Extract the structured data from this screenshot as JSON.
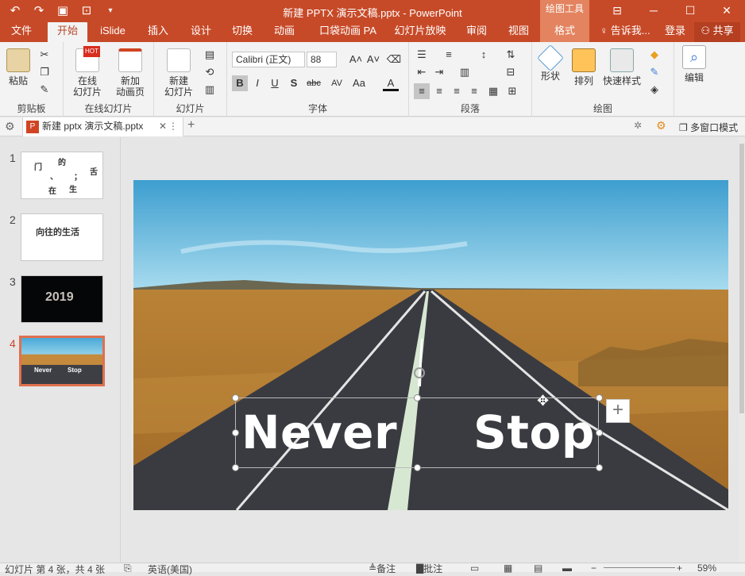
{
  "window": {
    "title": "新建 PPTX 演示文稿.pptx - PowerPoint",
    "context_tools": "绘图工具",
    "buttons": [
      "restore-ribbon",
      "minimize",
      "maximize",
      "close"
    ]
  },
  "tabs": [
    {
      "label": "文件"
    },
    {
      "label": "开始"
    },
    {
      "label": "iSlide"
    },
    {
      "label": "插入"
    },
    {
      "label": "设计"
    },
    {
      "label": "切换"
    },
    {
      "label": "动画"
    },
    {
      "label": "口袋动画 PA"
    },
    {
      "label": "幻灯片放映"
    },
    {
      "label": "审阅"
    },
    {
      "label": "视图"
    },
    {
      "label": "格式"
    }
  ],
  "tellme": "告诉我...",
  "login": "登录",
  "share": "共享",
  "ribbon": {
    "clipboard": {
      "paste": "粘贴",
      "label": "剪贴板"
    },
    "online": {
      "btn1": "在线\n幻灯片",
      "btn2": "新加\n动画页",
      "label": "在线幻灯片",
      "hot": "HOT"
    },
    "slides": {
      "btn": "新建\n幻灯片",
      "label": "幻灯片"
    },
    "font": {
      "name": "Calibri (正文)",
      "size": "88",
      "label": "字体",
      "b": "B",
      "i": "I",
      "u": "U",
      "s": "S",
      "abc": "abc",
      "av": "AV",
      "aa": "Aa",
      "a": "A"
    },
    "paragraph": {
      "label": "段落"
    },
    "drawing": {
      "shape": "形状",
      "arrange": "排列",
      "quickstyle": "快速样式",
      "label": "绘图"
    },
    "editing": {
      "label": "编辑"
    }
  },
  "doc_tab": {
    "name": "新建 pptx 演示文稿.pptx",
    "multiwindow": "多窗口模式"
  },
  "thumbnails": [
    {
      "num": "1",
      "lines": [
        "门",
        "的",
        "舌",
        "、",
        "；",
        "在",
        "生"
      ]
    },
    {
      "num": "2",
      "text": "向往的生活"
    },
    {
      "num": "3",
      "text": "2019"
    },
    {
      "num": "4",
      "text1": "Never",
      "text2": "Stop"
    }
  ],
  "slide": {
    "word1": "Never",
    "word2": "Stop"
  },
  "status": {
    "slide_info": "幻灯片 第 4 张，共 4 张",
    "language": "英语(美国)",
    "notes": "备注",
    "comments": "批注",
    "zoom": "59%"
  },
  "colors": {
    "accent": "#c74a28",
    "context": "#e3835f",
    "sky": "#62b6d6",
    "grass": "#c58a3c",
    "road": "#3e3f45"
  }
}
